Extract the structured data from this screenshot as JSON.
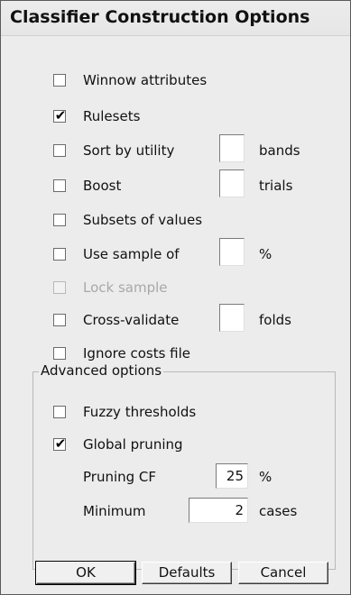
{
  "window": {
    "title": "Classifier Construction Options"
  },
  "options": {
    "winnow": {
      "label": "Winnow attributes",
      "checked": false
    },
    "rulesets": {
      "label": "Rulesets",
      "checked": true
    },
    "sort_by_utility": {
      "label": "Sort by utility",
      "checked": false,
      "value": "",
      "unit": "bands"
    },
    "boost": {
      "label": "Boost",
      "checked": false,
      "value": "",
      "unit": "trials"
    },
    "subsets": {
      "label": "Subsets of values",
      "checked": false
    },
    "use_sample": {
      "label": "Use sample of",
      "checked": false,
      "value": "",
      "unit": "%"
    },
    "lock_sample": {
      "label": "Lock sample",
      "checked": false,
      "disabled": true
    },
    "cross_validate": {
      "label": "Cross-validate",
      "checked": false,
      "value": "",
      "unit": "folds"
    },
    "ignore_costs": {
      "label": "Ignore costs file",
      "checked": false
    }
  },
  "advanced": {
    "title": "Advanced options",
    "fuzzy": {
      "label": "Fuzzy thresholds",
      "checked": false
    },
    "global_pruning": {
      "label": "Global pruning",
      "checked": true
    },
    "pruning_cf": {
      "label": "Pruning CF",
      "value": "25",
      "unit": "%"
    },
    "minimum": {
      "label": "Minimum",
      "value": "2",
      "unit": "cases"
    }
  },
  "buttons": {
    "ok": "OK",
    "defaults": "Defaults",
    "cancel": "Cancel"
  },
  "glyphs": {
    "check": "✔"
  }
}
